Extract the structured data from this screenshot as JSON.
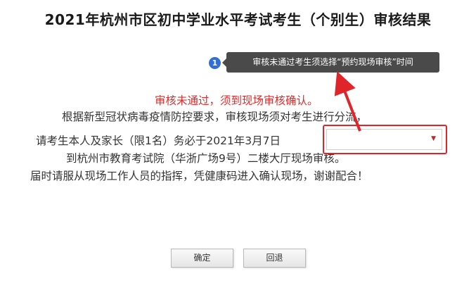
{
  "page": {
    "title": "2021年杭州市区初中学业水平考试考生（个别生）审核结果"
  },
  "tooltip": {
    "step": "1",
    "text": "审核未通过考生须选择“预约现场审核”时间"
  },
  "notice": {
    "warning": "审核未通过，须到现场审核确认。",
    "line2": "根据新型冠状病毒疫情防控要求，审核现场须对考生进行分流，",
    "line3_prefix": "请考生本人及家长（限1名）务必于2021年3月7日",
    "line4": "到杭州市教育考试院（华浙广场9号）二楼大厅现场审核。",
    "line5": "届时请服从现场工作人员的指挥，凭健康码进入确认现场，谢谢配合！"
  },
  "appointment_select": {
    "value": "",
    "arrow": "▼"
  },
  "buttons": {
    "confirm": "确定",
    "back": "回退"
  },
  "colors": {
    "warning_text": "#e02a2a",
    "highlight": "#e0252a",
    "badge": "#2e6fd8",
    "tooltip_bg": "#4a4a4a"
  }
}
